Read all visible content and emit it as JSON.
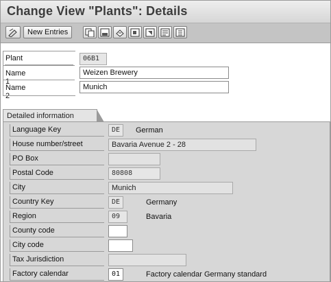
{
  "window": {
    "title": "Change View \"Plants\": Details"
  },
  "toolbar": {
    "new_entries_label": "New Entries",
    "icons": [
      "display-change-icon",
      "copy-icon",
      "save-as-icon",
      "undo-icon",
      "first-entry-icon",
      "previous-entry-icon",
      "next-entry-icon",
      "last-entry-icon",
      "other-entry-icon"
    ]
  },
  "plant": {
    "plant_label": "Plant",
    "plant_value": "06B1",
    "name1_label": "Name 1",
    "name1_value": "Weizen Brewery",
    "name2_label": "Name 2",
    "name2_value": "Munich"
  },
  "detail": {
    "tab_label": "Detailed information",
    "language_key_label": "Language Key",
    "language_key_value": "DE",
    "language_key_desc": "German",
    "house_label": "House number/street",
    "house_value": "Bavaria Avenue 2 - 28",
    "po_box_label": "PO Box",
    "po_box_value": "",
    "postal_label": "Postal Code",
    "postal_value": "80808",
    "city_label": "City",
    "city_value": "Munich",
    "country_label": "Country Key",
    "country_value": "DE",
    "country_desc": "Germany",
    "region_label": "Region",
    "region_value": "09",
    "region_desc": "Bavaria",
    "county_label": "County code",
    "county_value": "",
    "city_code_label": "City code",
    "city_code_value": "",
    "tax_label": "Tax Jurisdiction",
    "tax_value": "",
    "factory_label": "Factory calendar",
    "factory_value": "01",
    "factory_desc": "Factory calendar Germany standard"
  }
}
